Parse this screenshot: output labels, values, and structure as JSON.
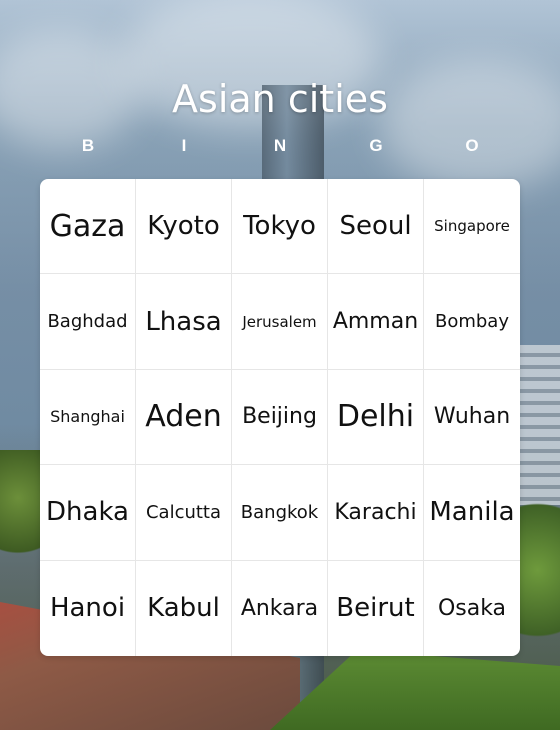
{
  "title": "Asian cities",
  "header_letters": [
    "B",
    "I",
    "N",
    "G",
    "O"
  ],
  "cells": [
    "Gaza",
    "Kyoto",
    "Tokyo",
    "Seoul",
    "Singapore",
    "Baghdad",
    "Lhasa",
    "Jerusalem",
    "Amman",
    "Bombay",
    "Shanghai",
    "Aden",
    "Beijing",
    "Delhi",
    "Wuhan",
    "Dhaka",
    "Calcutta",
    "Bangkok",
    "Karachi",
    "Manila",
    "Hanoi",
    "Kabul",
    "Ankara",
    "Beirut",
    "Osaka"
  ],
  "colors": {
    "title_text": "#ffffff",
    "board_bg": "#ffffff",
    "cell_text": "#111111",
    "grid_line": "#e6e6e6"
  }
}
